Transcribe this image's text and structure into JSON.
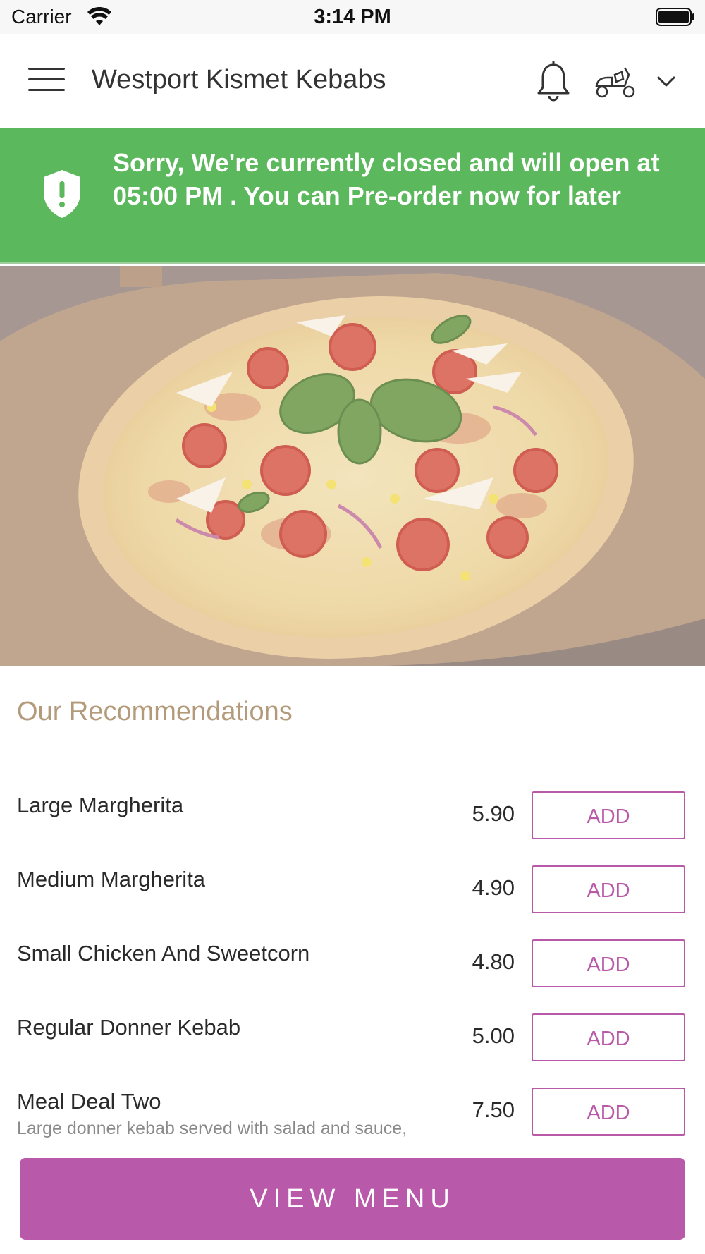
{
  "status_bar": {
    "carrier": "Carrier",
    "time": "3:14 PM"
  },
  "header": {
    "title": "Westport Kismet Kebabs",
    "icons": [
      "menu-icon",
      "bell-icon",
      "scooter-icon",
      "chevron-down-icon"
    ]
  },
  "banner": {
    "message": "Sorry, We're currently closed and will open at 05:00 PM . You can Pre-order now for later",
    "color": "#5cb85c",
    "icon": "shield-alert-icon"
  },
  "hero": {
    "image": "pizza"
  },
  "recommendations": {
    "title": "Our Recommendations",
    "items": [
      {
        "name": "Large Margherita",
        "description": "",
        "price": "5.90",
        "action": "ADD"
      },
      {
        "name": "Medium Margherita",
        "description": "",
        "price": "4.90",
        "action": "ADD"
      },
      {
        "name": "Small Chicken And Sweetcorn",
        "description": "",
        "price": "4.80",
        "action": "ADD"
      },
      {
        "name": "Regular Donner Kebab",
        "description": "",
        "price": "5.00",
        "action": "ADD"
      },
      {
        "name": "Meal Deal Two",
        "description": "Large donner kebab served with salad and sauce,",
        "price": "7.50",
        "action": "ADD"
      }
    ]
  },
  "footer": {
    "view_menu_label": "VIEW MENU",
    "accent": "#b859aa"
  }
}
